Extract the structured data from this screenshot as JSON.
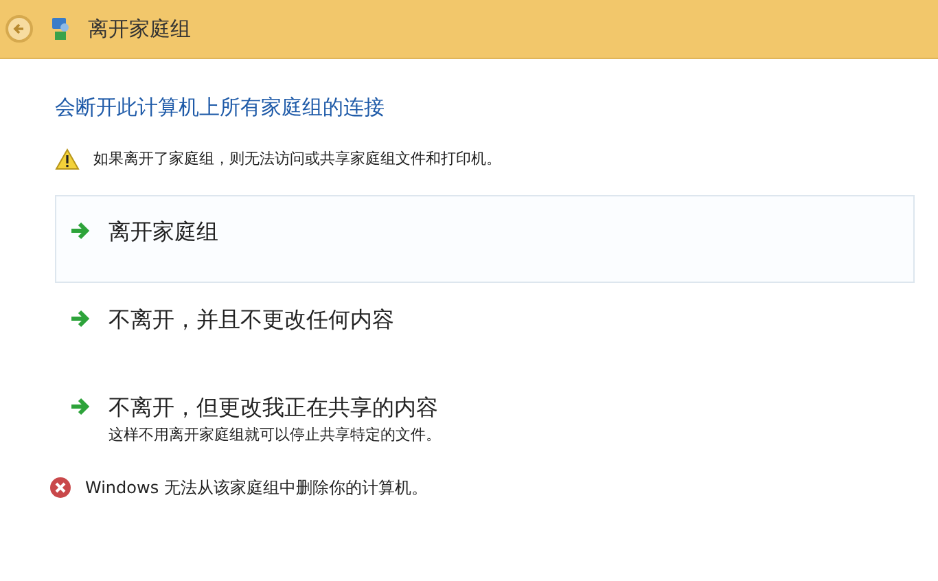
{
  "window": {
    "title": "离开家庭组"
  },
  "heading": "会断开此计算机上所有家庭组的连接",
  "warning": "如果离开了家庭组，则无法访问或共享家庭组文件和打印机。",
  "options": [
    {
      "label": "离开家庭组",
      "highlighted": true
    },
    {
      "label": "不离开，并且不更改任何内容",
      "highlighted": false
    },
    {
      "label": "不离开，但更改我正在共享的内容",
      "description": "这样不用离开家庭组就可以停止共享特定的文件。",
      "highlighted": false
    }
  ],
  "error": "Windows 无法从该家庭组中删除你的计算机。"
}
